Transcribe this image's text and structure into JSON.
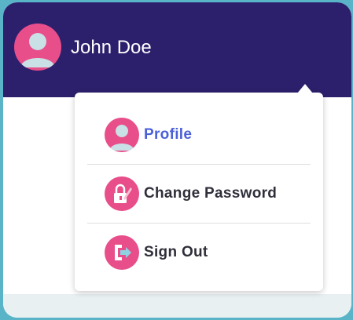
{
  "user": {
    "name": "John Doe"
  },
  "menu": {
    "items": [
      {
        "label": "Profile",
        "icon": "user-icon"
      },
      {
        "label": "Change Password",
        "icon": "password-lock-icon"
      },
      {
        "label": "Sign Out",
        "icon": "sign-out-icon"
      }
    ]
  },
  "colors": {
    "header": "#2c206c",
    "accent": "#e84e8a",
    "active_link": "#4b5fd8",
    "backdrop": "#5ab4c8"
  }
}
